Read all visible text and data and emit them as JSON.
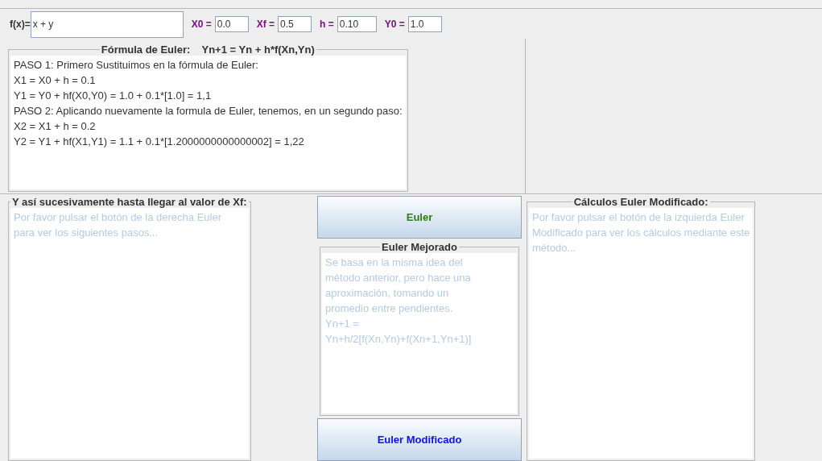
{
  "function_field": {
    "label": "f(x)=",
    "value": "x + y"
  },
  "params": [
    {
      "label": "X0 =",
      "value": "0.0"
    },
    {
      "label": "Xf =",
      "value": "0.5"
    },
    {
      "label": "h =",
      "value": "0.10"
    },
    {
      "label": "Y0 =",
      "value": "1.0"
    }
  ],
  "euler_panel": {
    "title": "Fórmula de Euler:    Yn+1 = Yn + h*f(Xn,Yn)",
    "lines": [
      "PASO 1: Primero Sustituimos en la fórmula de Euler:",
      "X1 = X0 + h = 0.1",
      "Y1 = Y0 + hf(X0,Y0) = 1.0 + 0.1*[1.0] = 1,1",
      "PASO 2: Aplicando nuevamente la formula de Euler, tenemos, en un segundo paso:",
      "X2 = X1 + h = 0.2",
      "Y2 = Y1 + hf(X1,Y1) = 1.1 + 0.1*[1.2000000000000002] = 1,22"
    ]
  },
  "steps_panel": {
    "title": "Y así sucesivamente hasta llegar al valor de Xf:",
    "lines": [
      "Por favor pulsar el botón de la derecha Euler",
      "para ver los siguientes pasos..."
    ]
  },
  "buttons": [
    {
      "label": "Euler",
      "color": "#2e7d0a"
    },
    {
      "label": "Euler Modificado",
      "color": "#0a14e6"
    }
  ],
  "improved_panel": {
    "title": "Euler Mejorado",
    "lines": [
      "Se basa en la misma idea del",
      "método anterior, pero hace una",
      "aproximación, tomando un",
      "promedio entre pendientes.",
      "Yn+1 =",
      "Yn+h/2[f(Xn,Yn)+f(Xn+1,Yn+1)]"
    ]
  },
  "modified_panel": {
    "title": "Cálculos Euler Modificado:",
    "lines": [
      "Por favor pulsar el botón de la izquierda Euler",
      "Modificado para ver los cálculos mediante este",
      "método..."
    ]
  }
}
